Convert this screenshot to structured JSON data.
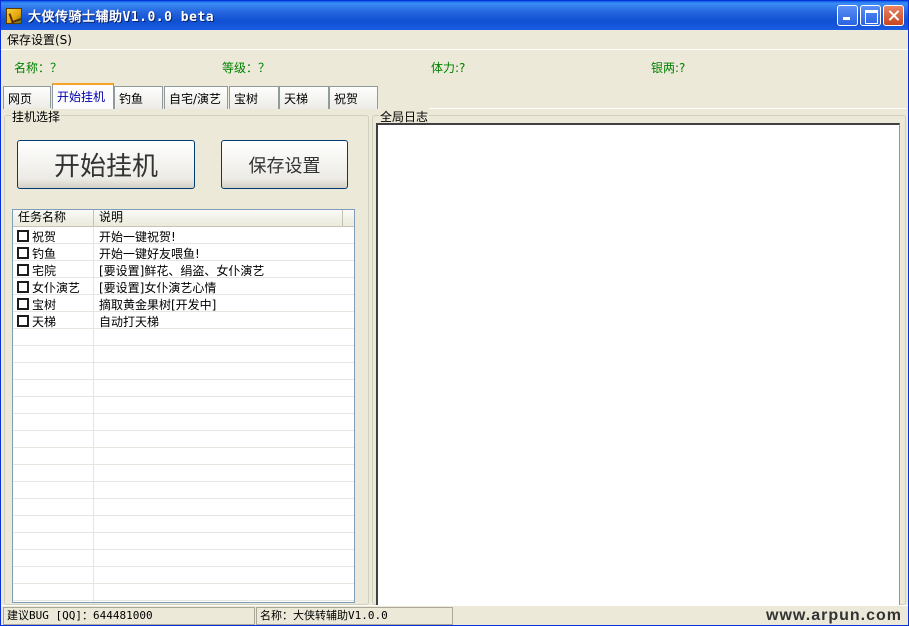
{
  "window": {
    "title": "大侠传骑士辅助V1.0.0 beta"
  },
  "menu": {
    "items": [
      "保存设置(S)"
    ]
  },
  "info": {
    "name_label": "名称：？",
    "level_label": "等级：？",
    "stamina_label": "体力:?",
    "silver_label": "银两:?"
  },
  "tabs": [
    "网页",
    "开始挂机",
    "钓鱼",
    "自宅/演艺",
    "宝树",
    "天梯",
    "祝贺"
  ],
  "active_tab": "开始挂机",
  "left_panel": {
    "legend": "挂机选择",
    "start_button": "开始挂机",
    "save_button": "保存设置",
    "columns": [
      "任务名称",
      "说明"
    ],
    "rows": [
      {
        "name": "祝贺",
        "desc": "开始一键祝贺!",
        "checked": false
      },
      {
        "name": "钓鱼",
        "desc": "开始一键好友喂鱼!",
        "checked": false
      },
      {
        "name": "宅院",
        "desc": "[要设置]鲜花、绢盗、女仆演艺",
        "checked": false
      },
      {
        "name": "女仆演艺",
        "desc": "[要设置]女仆演艺心情",
        "checked": false
      },
      {
        "name": "宝树",
        "desc": "摘取黄金果树[开发中]",
        "checked": false
      },
      {
        "name": "天梯",
        "desc": "自动打天梯",
        "checked": false
      }
    ]
  },
  "right_panel": {
    "legend": "全局日志"
  },
  "status": {
    "bug_report": "建议BUG [QQ]：644481000",
    "app_name": "名称：大侠转辅助V1.0.0",
    "watermark": "www.arpun.com"
  },
  "colors": {
    "info_text": "#008000",
    "title_bar": "#0f4fd2",
    "active_tab_accent": "#f5a427"
  }
}
